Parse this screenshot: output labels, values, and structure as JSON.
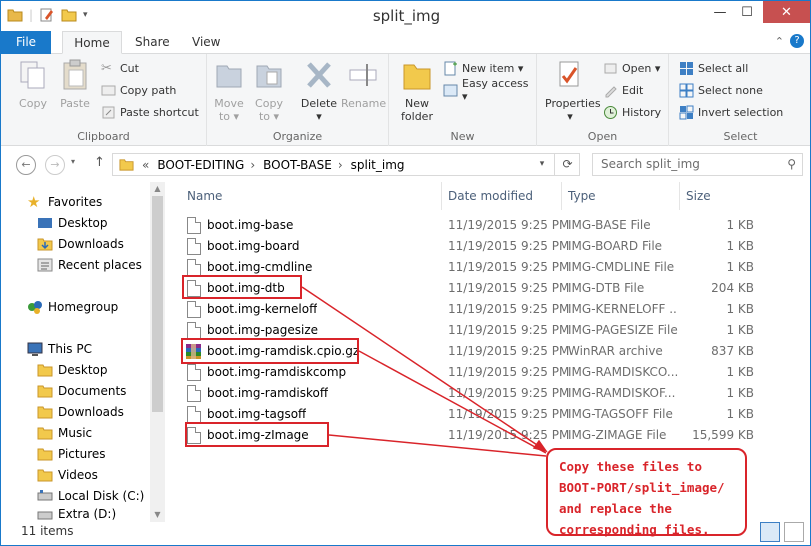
{
  "window": {
    "title": "split_img",
    "controls": {
      "minimize": "—",
      "maximize": "☐",
      "close": "✕"
    }
  },
  "tabs": [
    {
      "label": "File"
    },
    {
      "label": "Home"
    },
    {
      "label": "Share"
    },
    {
      "label": "View"
    }
  ],
  "ribbon": {
    "clipboard": {
      "label": "Clipboard",
      "copy": "Copy",
      "paste": "Paste",
      "cut": "Cut",
      "copy_path": "Copy path",
      "paste_shortcut": "Paste shortcut"
    },
    "organize": {
      "label": "Organize",
      "move_to": "Move",
      "move_to2": "to ▾",
      "copy_to": "Copy",
      "copy_to2": "to ▾",
      "delete": "Delete",
      "delete2": "▾",
      "rename": "Rename"
    },
    "new": {
      "label": "New",
      "new_folder": "New",
      "new_folder2": "folder",
      "new_item": "New item ▾",
      "easy_access": "Easy access ▾"
    },
    "open": {
      "label": "Open",
      "properties": "Properties",
      "properties2": "▾",
      "open": "Open ▾",
      "edit": "Edit",
      "history": "History"
    },
    "select": {
      "label": "Select",
      "select_all": "Select all",
      "select_none": "Select none",
      "invert": "Invert selection"
    }
  },
  "address": {
    "prefix": "«",
    "crumbs": [
      "BOOT-EDITING",
      "BOOT-BASE",
      "split_img"
    ],
    "sep": "›",
    "search_placeholder": "Search split_img"
  },
  "nav": {
    "favorites": {
      "label": "Favorites",
      "items": [
        "Desktop",
        "Downloads",
        "Recent places"
      ]
    },
    "homegroup": "Homegroup",
    "thispc": {
      "label": "This PC",
      "items": [
        "Desktop",
        "Documents",
        "Downloads",
        "Music",
        "Pictures",
        "Videos",
        "Local Disk (C:)",
        "Extra (D:)"
      ]
    }
  },
  "columns": {
    "name": "Name",
    "date": "Date modified",
    "type": "Type",
    "size": "Size"
  },
  "files": [
    {
      "name": "boot.img-base",
      "date": "11/19/2015 9:25 PM",
      "type": "IMG-BASE File",
      "size": "1 KB"
    },
    {
      "name": "boot.img-board",
      "date": "11/19/2015 9:25 PM",
      "type": "IMG-BOARD File",
      "size": "1 KB"
    },
    {
      "name": "boot.img-cmdline",
      "date": "11/19/2015 9:25 PM",
      "type": "IMG-CMDLINE File",
      "size": "1 KB"
    },
    {
      "name": "boot.img-dtb",
      "date": "11/19/2015 9:25 PM",
      "type": "IMG-DTB File",
      "size": "204 KB"
    },
    {
      "name": "boot.img-kerneloff",
      "date": "11/19/2015 9:25 PM",
      "type": "IMG-KERNELOFF ...",
      "size": "1 KB"
    },
    {
      "name": "boot.img-pagesize",
      "date": "11/19/2015 9:25 PM",
      "type": "IMG-PAGESIZE File",
      "size": "1 KB"
    },
    {
      "name": "boot.img-ramdisk.cpio.gz",
      "date": "11/19/2015 9:25 PM",
      "type": "WinRAR archive",
      "size": "837 KB"
    },
    {
      "name": "boot.img-ramdiskcomp",
      "date": "11/19/2015 9:25 PM",
      "type": "IMG-RAMDISKCO...",
      "size": "1 KB"
    },
    {
      "name": "boot.img-ramdiskoff",
      "date": "11/19/2015 9:25 PM",
      "type": "IMG-RAMDISKOF...",
      "size": "1 KB"
    },
    {
      "name": "boot.img-tagsoff",
      "date": "11/19/2015 9:25 PM",
      "type": "IMG-TAGSOFF File",
      "size": "1 KB"
    },
    {
      "name": "boot.img-zImage",
      "date": "11/19/2015 9:25 PM",
      "type": "IMG-ZIMAGE File",
      "size": "15,599 KB"
    }
  ],
  "status": {
    "count": "11 items"
  },
  "annotation": {
    "text": "Copy these files to\nBOOT-PORT/split_image/\nand replace the\ncorresponding files.",
    "color": "#d9242a"
  }
}
